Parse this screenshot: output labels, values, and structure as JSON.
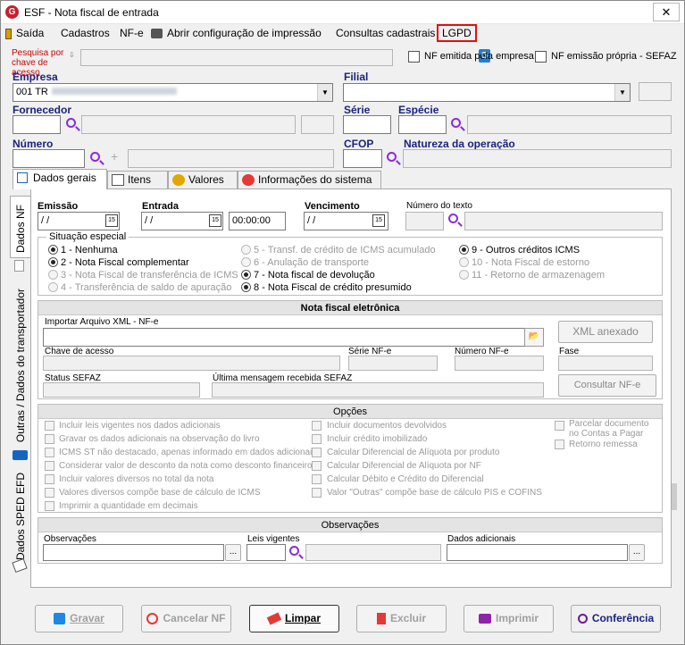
{
  "window": {
    "title": "ESF - Nota fiscal de entrada",
    "logo": "G",
    "close": "✕"
  },
  "menu": {
    "saida": "Saída",
    "cadastros": "Cadastros",
    "nfe": "NF-e",
    "abrir_config": "Abrir configuração de impressão",
    "consultas": "Consultas cadastrais",
    "lgpd": "LGPD"
  },
  "search": {
    "label": "Pesquisa por chave de acesso",
    "nf_empresa": "NF emitida pela empresa",
    "nf_propria": "NF emissão própria - SEFAZ"
  },
  "header": {
    "empresa_label": "Empresa",
    "empresa_value": "001 TR",
    "filial_label": "Filial",
    "fornecedor_label": "Fornecedor",
    "serie_label": "Série",
    "especie_label": "Espécie",
    "numero_label": "Número",
    "cfop_label": "CFOP",
    "natureza_label": "Natureza da operação"
  },
  "tabs": [
    "Dados gerais",
    "Itens",
    "Valores",
    "Informações do sistema"
  ],
  "vtabs": [
    "Dados NF",
    "Outras / Dados do transportador",
    "Dados SPED EFD"
  ],
  "dates": {
    "emissao_label": "Emissão",
    "emissao_value": "/ /",
    "entrada_label": "Entrada",
    "entrada_value": "/ /",
    "hora_value": "00:00:00",
    "vencimento_label": "Vencimento",
    "vencimento_value": "/ /",
    "numero_texto_label": "Número do texto",
    "cal_icon": "15"
  },
  "situacao": {
    "legend": "Situação especial",
    "options": [
      "1 - Nenhuma",
      "2 - Nota Fiscal complementar",
      "3 - Nota Fiscal de transferência de ICMS",
      "4 - Transferência de saldo de apuração",
      "5 - Transf. de crédito de ICMS acumulado",
      "6 - Anulação de transporte",
      "7 - Nota fiscal de devolução",
      "8 - Nota Fiscal de crédito presumido",
      "9 - Outros créditos ICMS",
      "10 - Nota Fiscal de estorno",
      "11 - Retorno de armazenagem"
    ],
    "selected": "1 - Nenhuma"
  },
  "nfe": {
    "heading": "Nota fiscal eletrônica",
    "importar_label": "Importar Arquivo XML - NF-e",
    "xml_anexado": "XML anexado",
    "chave_label": "Chave de acesso",
    "serie_label": "Série NF-e",
    "numero_label": "Número NF-e",
    "fase_label": "Fase",
    "status_label": "Status SEFAZ",
    "ultima_label": "Última mensagem recebida SEFAZ",
    "consultar": "Consultar NF-e"
  },
  "opcoes": {
    "heading": "Opções",
    "col1": [
      "Incluir leis vigentes nos dados adicionais",
      "Gravar os dados adicionais na observação do livro",
      "ICMS ST não destacado, apenas informado em dados adicionais",
      "Considerar valor de desconto da nota como desconto financeiro",
      "Incluir valores diversos no total da nota",
      "Valores diversos compõe base de cálculo de ICMS",
      "Imprimir a quantidade em decimais"
    ],
    "col2": [
      "Incluir documentos devolvidos",
      "Incluir crédito imobilizado",
      "Calcular Diferencial de Alíquota por produto",
      "Calcular Diferencial de Alíquota por NF",
      "Calcular Débito e Crédito do Diferencial",
      "Valor \"Outras\" compõe base de cálculo PIS e COFINS"
    ],
    "col3": [
      "Parcelar documento no Contas a Pagar",
      "Retorno remessa"
    ]
  },
  "obs": {
    "heading": "Observações",
    "observacoes_label": "Observações",
    "leis_label": "Leis vigentes",
    "dados_label": "Dados adicionais",
    "ellipsis": "..."
  },
  "buttons": {
    "gravar": "Gravar",
    "cancelar": "Cancelar NF",
    "limpar": "Limpar",
    "excluir": "Excluir",
    "imprimir": "Imprimir",
    "conferencia": "Conferência"
  },
  "colors": {
    "accent": "#1a237e",
    "lgpd_border": "#e01010",
    "required": "#d00000",
    "magnifier": "#8a2be2"
  }
}
